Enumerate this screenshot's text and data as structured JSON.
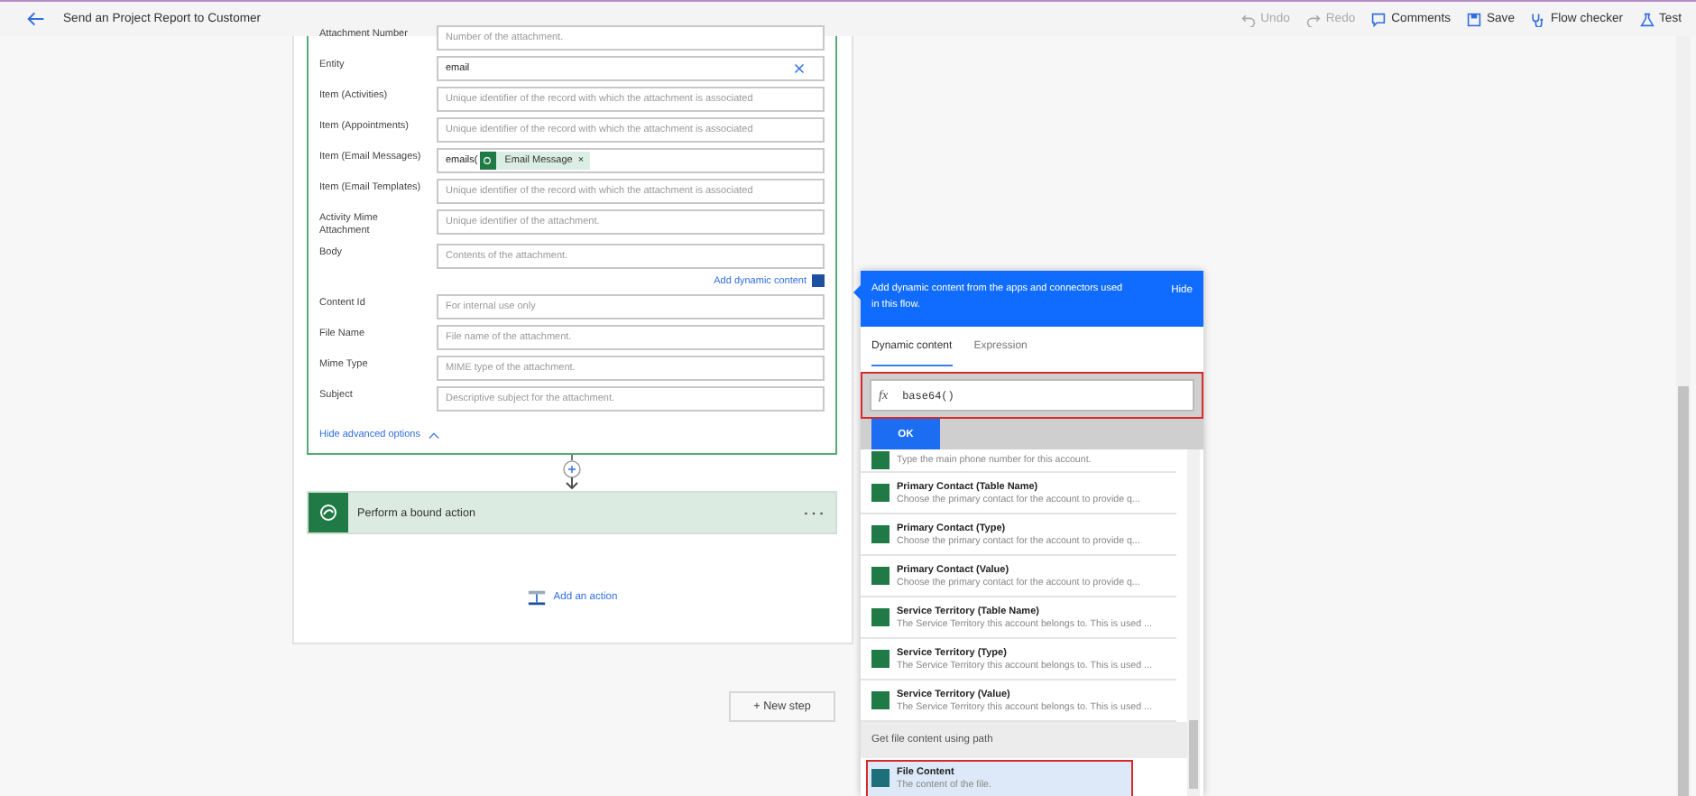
{
  "header": {
    "title": "Send an Project Report to Customer",
    "commands": [
      {
        "kind": "undo",
        "label": "Undo",
        "disabled": true
      },
      {
        "kind": "redo",
        "label": "Redo",
        "disabled": true
      },
      {
        "kind": "comments",
        "label": "Comments",
        "disabled": false
      },
      {
        "kind": "save",
        "label": "Save",
        "disabled": false
      },
      {
        "kind": "checker",
        "label": "Flow checker",
        "disabled": false
      },
      {
        "kind": "test",
        "label": "Test",
        "disabled": false
      }
    ]
  },
  "action_card": {
    "fields": [
      {
        "kind": "text",
        "label": "Attachment Number",
        "placeholder": "Number of the attachment."
      },
      {
        "kind": "clearable",
        "label": "Entity",
        "value": "email"
      },
      {
        "kind": "text",
        "label": "Item (Activities)",
        "placeholder": "Unique identifier of the record with which the attachment is associated"
      },
      {
        "kind": "text",
        "label": "Item (Appointments)",
        "placeholder": "Unique identifier of the record with which the attachment is associated"
      },
      {
        "kind": "token",
        "label": "Item (Email Messages)",
        "value": "emails(",
        "token": "Email Message",
        "remove": "×"
      },
      {
        "kind": "text",
        "label": "Item (Email Templates)",
        "placeholder": "Unique identifier of the record with which the attachment is associated"
      },
      {
        "kind": "text",
        "label": "Activity Mime Attachment",
        "placeholder": "Unique identifier of the attachment."
      },
      {
        "kind": "text",
        "label": "Body",
        "placeholder": "Contents of the attachment.",
        "dynamic_link": "Add dynamic content"
      },
      {
        "kind": "text",
        "label": "Content Id",
        "placeholder": "For internal use only"
      },
      {
        "kind": "text",
        "label": "File Name",
        "placeholder": "File name of the attachment."
      },
      {
        "kind": "text",
        "label": "Mime Type",
        "placeholder": "MIME type of the attachment."
      },
      {
        "kind": "text",
        "label": "Subject",
        "placeholder": "Descriptive subject for the attachment."
      }
    ],
    "hide_advanced": "Hide advanced options"
  },
  "next_action": {
    "title": "Perform a bound action"
  },
  "add_action": "Add an action",
  "new_step": "+ New step",
  "dynamic_panel": {
    "intro": "Add dynamic content from the apps and connectors used in this flow.",
    "hide": "Hide",
    "tabs": [
      {
        "label": "Dynamic content",
        "selected": true
      },
      {
        "label": "Expression",
        "selected": false
      }
    ],
    "expression_symbol": "fx",
    "expression": "base64()",
    "ok": "OK",
    "items": [
      {
        "description": "Type the main phone number for this account.",
        "selected": false
      },
      {
        "title": "Primary Contact (Table Name)",
        "description": "Choose the primary contact for the account to provide q...",
        "selected": false
      },
      {
        "title": "Primary Contact (Type)",
        "description": "Choose the primary contact for the account to provide q...",
        "selected": false
      },
      {
        "title": "Primary Contact (Value)",
        "description": "Choose the primary contact for the account to provide q...",
        "selected": false
      },
      {
        "title": "Service Territory (Table Name)",
        "description": "The Service Territory this account belongs to. This is used ...",
        "selected": false
      },
      {
        "title": "Service Territory (Type)",
        "description": "The Service Territory this account belongs to. This is used ...",
        "selected": false
      },
      {
        "title": "Service Territory (Value)",
        "description": "The Service Territory this account belongs to. This is used ...",
        "selected": false
      }
    ],
    "section": "Get file content using path",
    "section_items": [
      {
        "title": "File Content",
        "description": "The content of the file.",
        "selected": true
      }
    ]
  }
}
